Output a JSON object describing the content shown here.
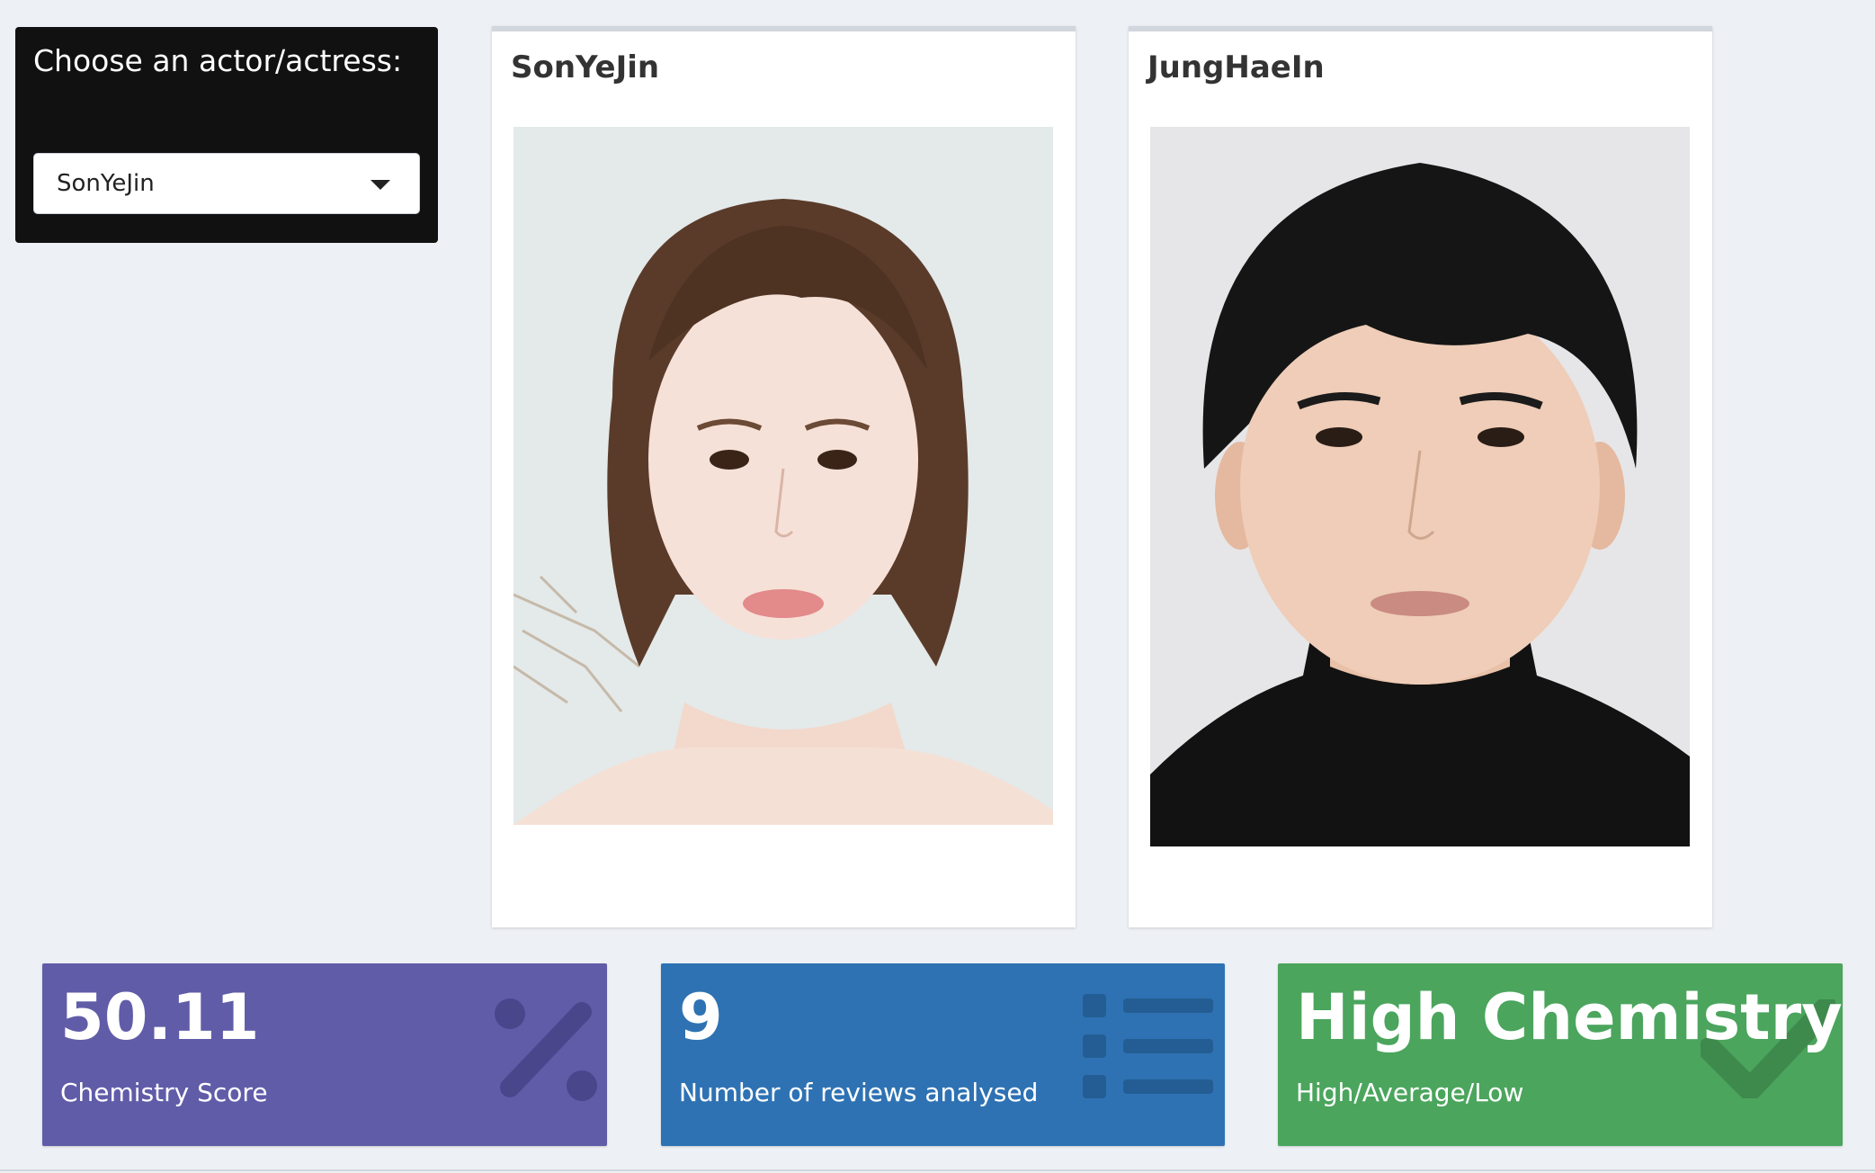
{
  "selector": {
    "label": "Choose an actor/actress:",
    "selected_value": "SonYeJin"
  },
  "cards": [
    {
      "title": "SonYeJin",
      "photo_alt": "SonYeJin"
    },
    {
      "title": "JungHaeIn",
      "photo_alt": "JungHaeIn"
    }
  ],
  "value_boxes": [
    {
      "value": "50.11",
      "subtitle": "Chemistry Score",
      "color": "#605ca8",
      "icon": "percent-icon"
    },
    {
      "value": "9",
      "subtitle": "Number of reviews analysed",
      "color": "#2e72b3",
      "icon": "list-icon"
    },
    {
      "value": "High Chemistry",
      "subtitle": "High/Average/Low",
      "color": "#4ba55d",
      "icon": "check-icon"
    }
  ]
}
